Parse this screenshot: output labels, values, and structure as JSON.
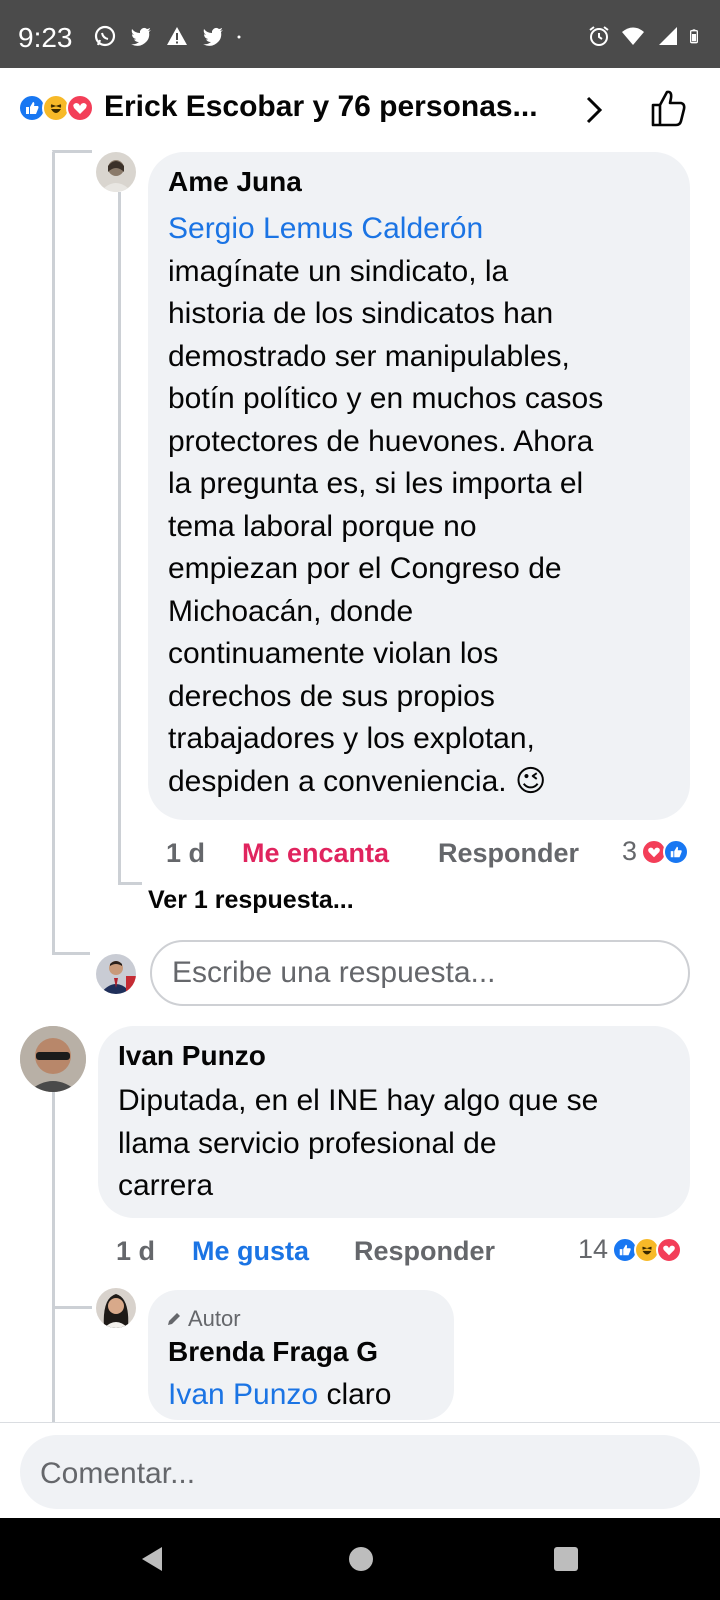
{
  "status_bar": {
    "time": "9:23",
    "left_icons": [
      "whatsapp-icon",
      "twitter-icon",
      "warning-icon",
      "twitter-icon",
      "dot-icon"
    ],
    "right_icons": [
      "alarm-icon",
      "wifi-icon",
      "signal-icon",
      "battery-icon"
    ]
  },
  "reactions_header": {
    "text": "Erick Escobar y 76 personas...",
    "icons": [
      "like-reaction-icon",
      "haha-reaction-icon",
      "love-reaction-icon"
    ]
  },
  "comments": [
    {
      "author": "Ame Juna",
      "mention": "Sergio Lemus Calderón",
      "lines": [
        "imagínate un sindicato, la",
        "historia de los sindicatos han",
        "demostrado ser manipulables,",
        "botín político y en muchos casos",
        "protectores de huevones. Ahora",
        "la pregunta es, si les importa el",
        "tema laboral porque no",
        "empiezan por el Congreso de",
        "Michoacán, donde",
        "continuamente violan los",
        "derechos de sus propios",
        "trabajadores y los explotan,",
        "despiden a conveniencia."
      ],
      "emoji": "😉",
      "time": "1 d",
      "reaction_label": "Me encanta",
      "reply_label": "Responder",
      "reaction_count": "3",
      "view_replies": "Ver 1 respuesta..."
    },
    {
      "author": "Ivan Punzo",
      "lines": [
        "Diputada, en el INE hay algo que se",
        "llama servicio profesional de",
        "carrera"
      ],
      "time": "1 d",
      "reaction_label": "Me gusta",
      "reply_label": "Responder",
      "reaction_count": "14"
    },
    {
      "badge": "Autor",
      "author": "Brenda Fraga G",
      "mention": "Ivan Punzo",
      "text": "claro"
    }
  ],
  "reply_placeholder": "Escribe una respuesta...",
  "comment_placeholder": "Comentar...",
  "colors": {
    "status_bar": "#4b4b4b",
    "bubble": "#f0f2f5",
    "mention": "#1b74e4",
    "love": "#e0245e",
    "like": "#1877f2",
    "secondary_text": "#65676b"
  }
}
